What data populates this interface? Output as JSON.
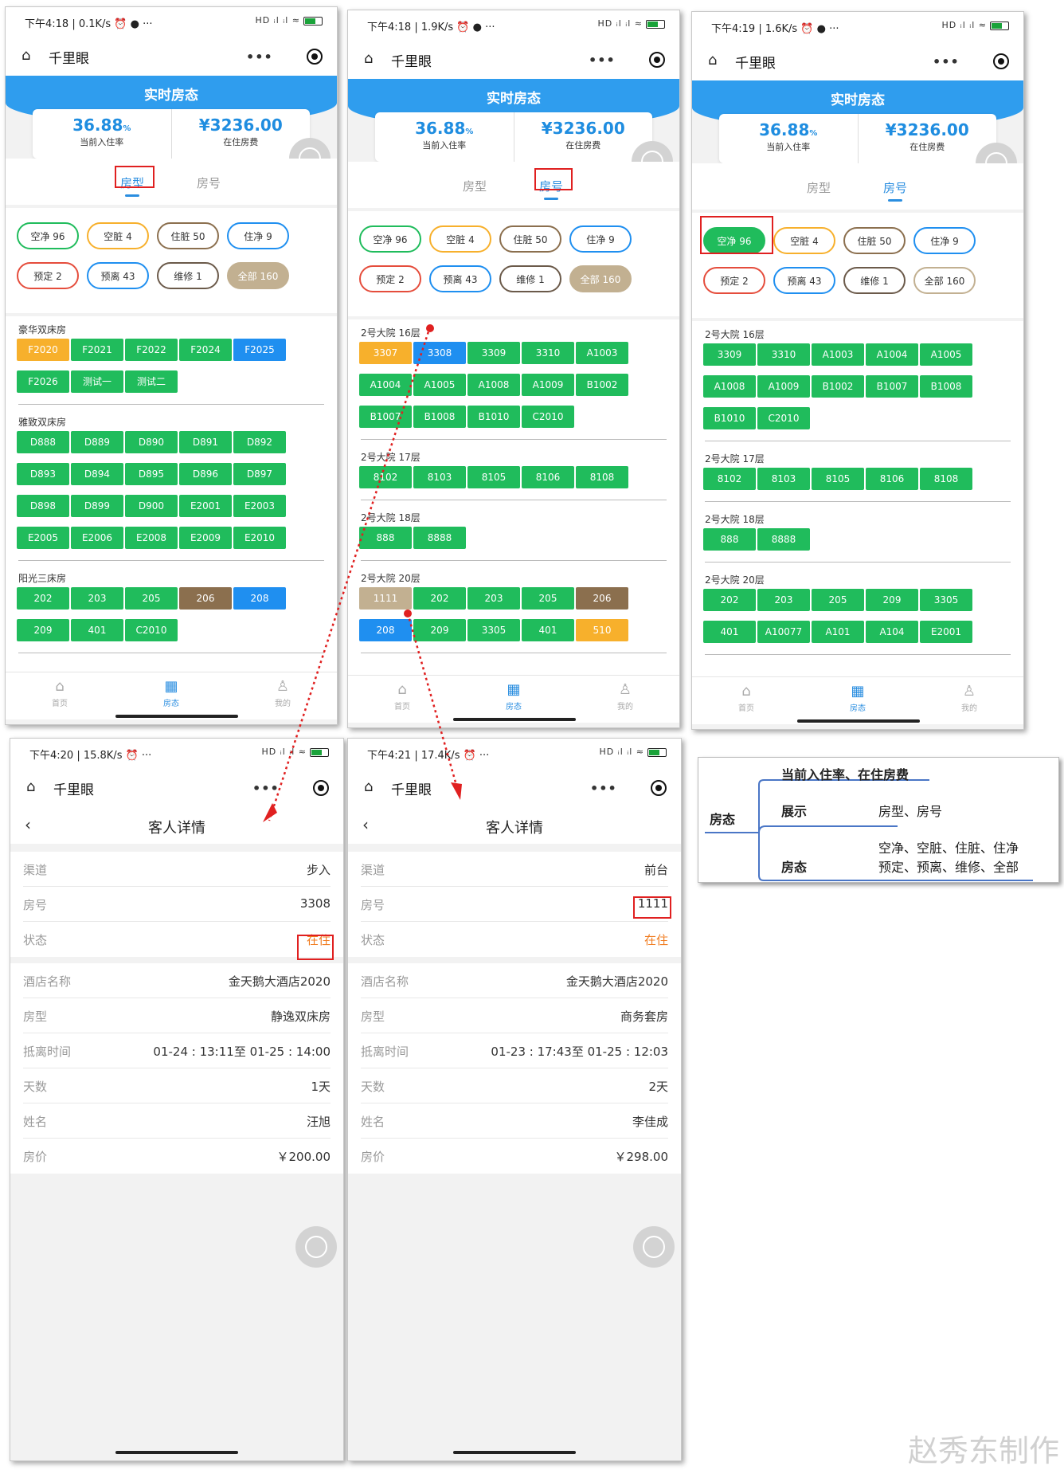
{
  "status_bar": {
    "p1": {
      "time": "下午4:18 | 0.1K/s ⏰ ● ···",
      "batt": "61"
    },
    "p2": {
      "time": "下午4:18 | 1.9K/s ⏰ ● ···",
      "batt": "61"
    },
    "p3": {
      "time": "下午4:19 | 1.6K/s ⏰ ● ···",
      "batt": "62"
    },
    "p4": {
      "time": "下午4:20 | 15.8K/s ⏰ ···",
      "batt": "62"
    },
    "p5": {
      "time": "下午4:21 | 17.4K/s ⏰ ···",
      "batt": "62"
    },
    "signal": "HD ᵢl ᵢl ≈"
  },
  "app": {
    "title": "千里眼",
    "home_icon": "⌂",
    "more": "•••"
  },
  "banner": {
    "title": "实时房态"
  },
  "stats": {
    "occupancy": "36.88",
    "occupancy_unit": "%",
    "occupancy_label": "当前入住率",
    "fee": "¥3236.00",
    "fee_label": "在住房费"
  },
  "tabs": {
    "type": "房型",
    "number": "房号"
  },
  "filters": [
    "空净 96",
    "空脏 4",
    "住脏 50",
    "住净 9",
    "预定 2",
    "预离 43",
    "维修 1",
    "全部 160"
  ],
  "colors": {
    "green": "#20bc5c",
    "orange": "#f7b02c",
    "blue": "#1f8ff0",
    "brown": "#8b6f4e",
    "tan": "#c2b091",
    "primary": "#2f9dee"
  },
  "p1_groups": [
    {
      "name": "豪华双床房",
      "rooms": [
        "F2020",
        "F2021",
        "F2022",
        "F2024",
        "F2025",
        "F2026",
        "测试一",
        "测试二"
      ]
    },
    {
      "name": "雅致双床房",
      "rooms": [
        "D888",
        "D889",
        "D890",
        "D891",
        "D892",
        "D893",
        "D894",
        "D895",
        "D896",
        "D897",
        "D898",
        "D899",
        "D900",
        "E2001",
        "E2003",
        "E2005",
        "E2006",
        "E2008",
        "E2009",
        "E2010"
      ]
    },
    {
      "name": "阳光三床房",
      "rooms": [
        "202",
        "203",
        "205",
        "206",
        "208",
        "209",
        "401",
        "C2010"
      ]
    }
  ],
  "p2_groups": [
    {
      "name": "2号大院  16层",
      "rooms": [
        "3307",
        "3308",
        "3309",
        "3310",
        "A1003",
        "A1004",
        "A1005",
        "A1008",
        "A1009",
        "B1002",
        "B1007",
        "B1008",
        "B1010",
        "C2010"
      ]
    },
    {
      "name": "2号大院  17层",
      "rooms": [
        "8102",
        "8103",
        "8105",
        "8106",
        "8108"
      ]
    },
    {
      "name": "2号大院  18层",
      "rooms": [
        "888",
        "8888"
      ]
    },
    {
      "name": "2号大院  20层",
      "rooms": [
        "1111",
        "202",
        "203",
        "205",
        "206",
        "208",
        "209",
        "3305",
        "401",
        "510"
      ]
    }
  ],
  "p3_groups": [
    {
      "name": "2号大院  16层",
      "rooms": [
        "3309",
        "3310",
        "A1003",
        "A1004",
        "A1005",
        "A1008",
        "A1009",
        "B1002",
        "B1007",
        "B1008",
        "B1010",
        "C2010"
      ]
    },
    {
      "name": "2号大院  17层",
      "rooms": [
        "8102",
        "8103",
        "8105",
        "8106",
        "8108"
      ]
    },
    {
      "name": "2号大院  18层",
      "rooms": [
        "888",
        "8888"
      ]
    },
    {
      "name": "2号大院  20层",
      "rooms": [
        "202",
        "203",
        "205",
        "209",
        "3305",
        "401",
        "A10077",
        "A101",
        "A104",
        "E2001"
      ]
    }
  ],
  "tabbar": {
    "home": "首页",
    "status": "房态",
    "mine": "我的"
  },
  "detail": {
    "title": "客人详情",
    "labels": {
      "channel": "渠道",
      "room": "房号",
      "status": "状态",
      "hotel": "酒店名称",
      "type": "房型",
      "time": "抵离时间",
      "days": "天数",
      "name": "姓名",
      "price": "房价"
    },
    "d1": {
      "channel": "步入",
      "room": "3308",
      "status": "在住",
      "hotel": "金天鹅大酒店2020",
      "type": "静逸双床房",
      "time": "01-24 : 13:11至 01-25 : 14:00",
      "days": "1天",
      "name": "汪旭",
      "price": "￥200.00"
    },
    "d2": {
      "channel": "前台",
      "room": "1111",
      "status": "在住",
      "hotel": "金天鹅大酒店2020",
      "type": "商务套房",
      "time": "01-23 : 17:43至 01-25 : 12:03",
      "days": "2天",
      "name": "李佳成",
      "price": "￥298.00"
    }
  },
  "mindmap": {
    "top": "当前入住率、在住房费",
    "root": "房态",
    "b1": "展示",
    "b1v": "房型、房号",
    "b2": "房态",
    "b2v1": "空净、空脏、住脏、住净",
    "b2v2": "预定、预离、维修、全部"
  },
  "watermark": "赵秀东制作"
}
